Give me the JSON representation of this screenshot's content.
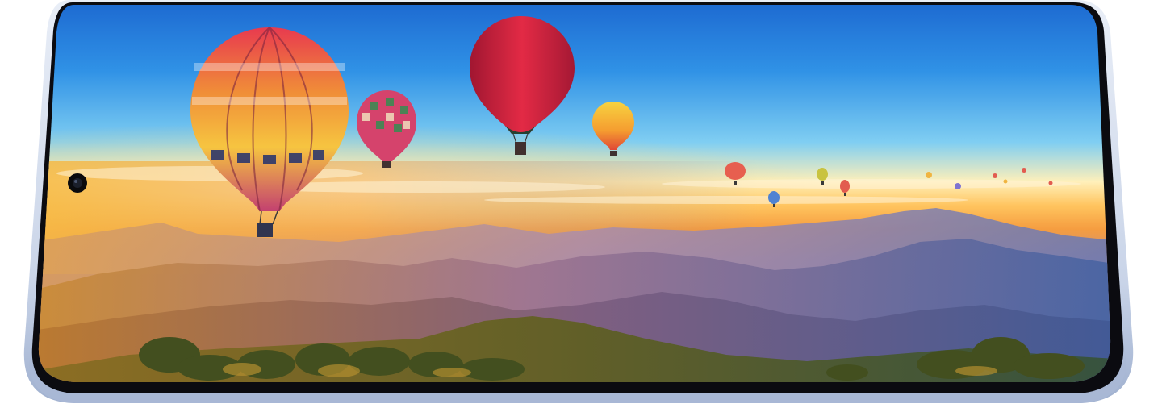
{
  "scene": {
    "subject": "smartphone-landscape",
    "icon_names": [
      "front-camera-icon"
    ],
    "colors": {
      "sky_top": "#1a73d9",
      "sky_mid": "#4fb6ee",
      "horizon_glow": "#ffd26b",
      "sunset_orange": "#f59a3a",
      "mountain_violet": "#6e5fa8",
      "mountain_blue": "#3f5fa0",
      "foreground_green": "#5c6b1f",
      "frame_silver": "#c8d3e6"
    }
  }
}
